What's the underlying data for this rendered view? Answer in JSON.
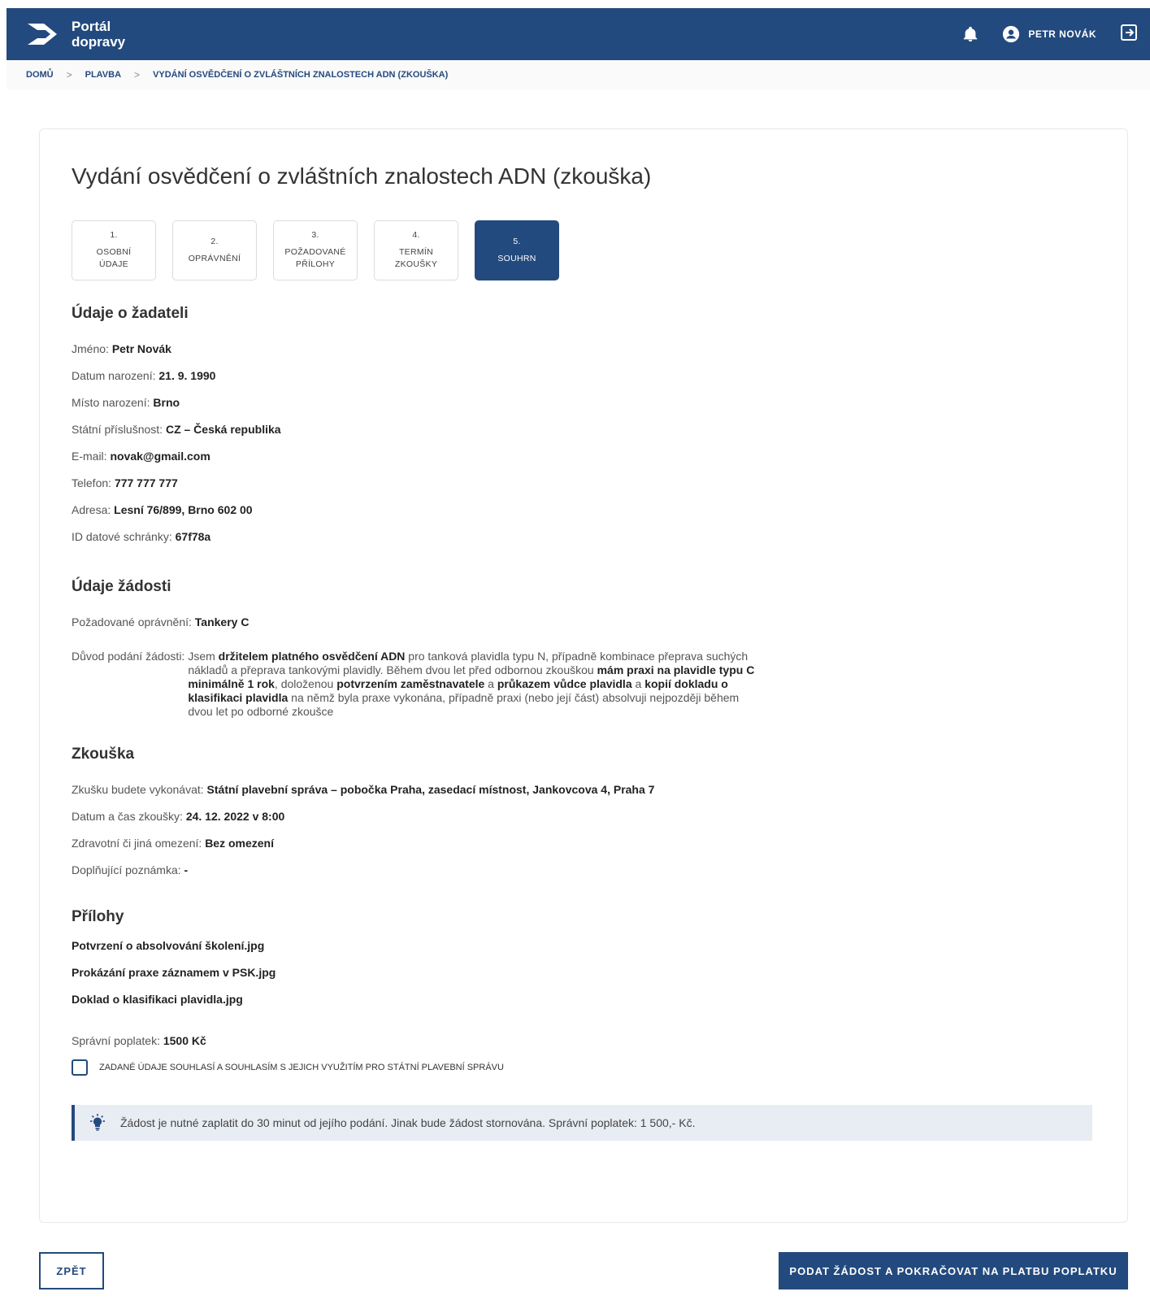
{
  "header": {
    "logo_line1": "Portál",
    "logo_line2": "dopravy",
    "user_name": "PETR NOVÁK",
    "icons": [
      "bell-icon",
      "user-avatar-icon",
      "logout-icon"
    ]
  },
  "breadcrumb": [
    "DOMŮ",
    "PLAVBA",
    "VYDÁNÍ OSVĚDČENÍ O ZVLÁŠTNÍCH ZNALOSTECH ADN (ZKOUŠKA)"
  ],
  "page_title": "Vydání osvědčení o zvláštních znalostech ADN (zkouška)",
  "steps": [
    {
      "num": "1.",
      "label": "OSOBNÍ\nÚDAJE",
      "active": false
    },
    {
      "num": "2.",
      "label": "OPRÁVNĚNÍ",
      "active": false
    },
    {
      "num": "3.",
      "label": "POŽADOVANÉ\nPŘÍLOHY",
      "active": false
    },
    {
      "num": "4.",
      "label": "TERMÍN\nZKOUŠKY",
      "active": false
    },
    {
      "num": "5.",
      "label": "SOUHRN",
      "active": true
    }
  ],
  "applicant": {
    "heading": "Údaje o žadateli",
    "fields": [
      {
        "label": "Jméno:",
        "value": "Petr Novák"
      },
      {
        "label": "Datum narození:",
        "value": "21. 9. 1990"
      },
      {
        "label": "Místo narození:",
        "value": "Brno"
      },
      {
        "label": "Státní příslušnost:",
        "value": "CZ – Česká republika"
      },
      {
        "label": "E-mail:",
        "value": "novak@gmail.com"
      },
      {
        "label": "Telefon:",
        "value": "777 777 777"
      },
      {
        "label": "Adresa:",
        "value": "Lesní 76/899, Brno 602 00"
      },
      {
        "label": "ID datové schránky:",
        "value": "67f78a"
      }
    ]
  },
  "request": {
    "heading": "Údaje žádosti",
    "permission_label": "Požadované oprávnění:",
    "permission_value": "Tankery C",
    "reason_label": "Důvod podání žádosti:",
    "reason_parts": [
      {
        "t": "Jsem ",
        "b": false
      },
      {
        "t": "držitelem platného osvědčení ADN",
        "b": true
      },
      {
        "t": " pro tanková plavidla typu N, případně kombinace přeprava suchých nákladů a přeprava tankovými plavidly. Během dvou let před odbornou zkouškou ",
        "b": false
      },
      {
        "t": "mám praxi na plavidle typu C minimálně 1 rok",
        "b": true
      },
      {
        "t": ", doloženou ",
        "b": false
      },
      {
        "t": "potvrzením zaměstnavatele",
        "b": true
      },
      {
        "t": " a ",
        "b": false
      },
      {
        "t": "průkazem vůdce plavidla",
        "b": true
      },
      {
        "t": " a ",
        "b": false
      },
      {
        "t": "kopií dokladu o klasifikaci plavidla",
        "b": true
      },
      {
        "t": " na němž byla praxe vykonána, případně praxi (nebo její část) absolvuji nejpozději během dvou let po odborné zkoušce",
        "b": false
      }
    ]
  },
  "exam": {
    "heading": "Zkouška",
    "fields": [
      {
        "label": "Zkušku budete vykonávat:",
        "value": "Státní plavební správa – pobočka Praha, zasedací místnost, Jankovcova 4, Praha 7"
      },
      {
        "label": "Datum a čas zkoušky:",
        "value": "24. 12. 2022 v 8:00"
      },
      {
        "label": "Zdravotní či jiná omezení:",
        "value": "Bez omezení"
      },
      {
        "label": "Doplňující poznámka:",
        "value": "-"
      }
    ]
  },
  "attachments": {
    "heading": "Přílohy",
    "files": [
      "Potvrzení o absolvování školení.jpg",
      "Prokázání praxe záznamem v PSK.jpg",
      "Doklad o klasifikaci plavidla.jpg"
    ]
  },
  "fee": {
    "label": "Správní poplatek:",
    "value": "1500 Kč"
  },
  "consent": {
    "label": "ZADANÉ ÚDAJE SOUHLASÍ A SOUHLASÍM S JEJICH VYUŽITÍM PRO STÁTNÍ PLAVEBNÍ SPRÁVU",
    "checked": false
  },
  "info_box": {
    "text": "Žádost je nutné zaplatit do 30 minut od jejího podání. Jinak bude žádost stornována. Správní poplatek: 1 500,- Kč.",
    "icon": "lightbulb-icon"
  },
  "buttons": {
    "back": "ZPĚT",
    "submit": "PODAT ŽÁDOST A POKRAČOVAT NA PLATBU POPLATKU"
  },
  "colors": {
    "primary": "#234a7e",
    "info_bg": "#e8edf3"
  }
}
